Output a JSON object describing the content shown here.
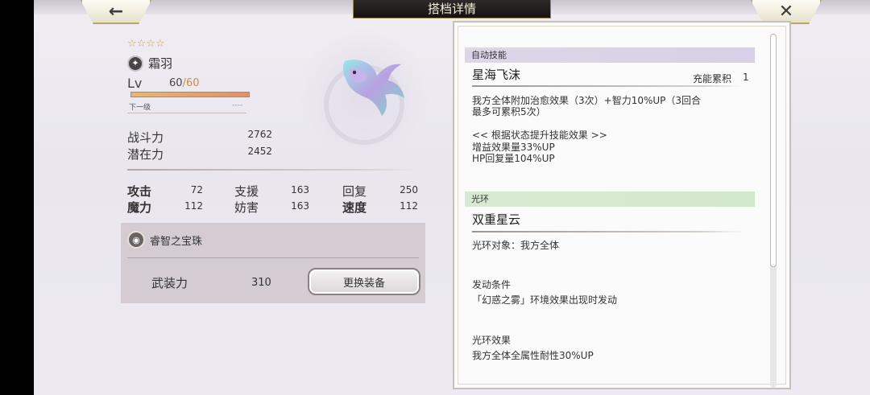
{
  "header": {
    "title": "搭档详情",
    "back_icon": "←",
    "close_icon": "✕"
  },
  "character": {
    "stars": "☆☆☆☆",
    "element_icon": "✦",
    "name": "霜羽",
    "lv_label": "Lv",
    "lv_current": "60",
    "lv_sep": "/",
    "lv_max": "60",
    "lv_progress": 1.0,
    "next_label": "下一级",
    "next_value": "----"
  },
  "power": {
    "battle_label": "战斗力",
    "battle_value": "2762",
    "potential_label": "潜在力",
    "potential_value": "2452"
  },
  "stats": [
    {
      "label": "攻击",
      "value": "72"
    },
    {
      "label": "支援",
      "value": "163"
    },
    {
      "label": "回复",
      "value": "250"
    },
    {
      "label": "魔力",
      "value": "112"
    },
    {
      "label": "妨害",
      "value": "163"
    },
    {
      "label": "速度",
      "value": "112"
    }
  ],
  "equipment": {
    "icon": "◉",
    "name": "睿智之宝珠",
    "arm_label": "武装力",
    "arm_value": "310",
    "change_button": "更换装备"
  },
  "auto_skill": {
    "header": "自动技能",
    "name": "星海飞沫",
    "charge_label": "充能累积",
    "charge_value": "1",
    "desc_line1": "我方全体附加治愈效果（3次）+智力10%UP（3回合",
    "desc_line2": "最多可累积5次）",
    "boost_title": "<< 根据状态提升技能效果 >>",
    "boost_line1": "增益效果量33%UP",
    "boost_line2": "HP回复量104%UP"
  },
  "aura": {
    "header": "光环",
    "name": "双重星云",
    "target": "光环对象：我方全体",
    "cond_title": "发动条件",
    "cond_text": "「幻惑之雾」环境效果出现时发动",
    "effect_title": "光环效果",
    "effect_text": "我方全体全属性耐性30%UP"
  },
  "colors": {
    "accent_gold": "#c6a34a",
    "skill_header": "#ddd6e8",
    "aura_header": "#d8ebd2",
    "lv_max": "#d78a3a"
  }
}
